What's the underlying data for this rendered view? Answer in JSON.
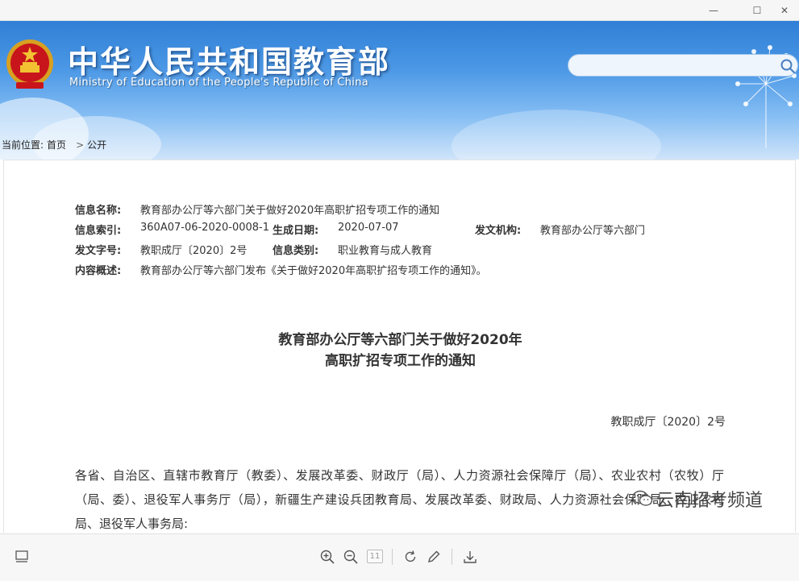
{
  "window": {
    "minimize_glyph": "—",
    "maximize_glyph": "☐",
    "close_glyph": "✕"
  },
  "header": {
    "title": "中华人民共和国教育部",
    "subtitle": "Ministry of Education of the People's Republic of China",
    "emblem_icon": "national-emblem-icon",
    "search": {
      "placeholder": "",
      "icon": "search-icon"
    }
  },
  "breadcrumb": {
    "prefix": "当前位置:",
    "items": [
      "首页",
      "公开"
    ],
    "separator": ">"
  },
  "meta": {
    "name_label": "信息名称:",
    "name_value": "教育部办公厅等六部门关于做好2020年高职扩招专项工作的通知",
    "index_label": "信息索引:",
    "index_value": "360A07-06-2020-0008-1",
    "date_label": "生成日期:",
    "date_value": "2020-07-07",
    "issuer_label": "发文机构:",
    "issuer_value": "教育部办公厅等六部门",
    "docno_label": "发文字号:",
    "docno_value": "教职成厅〔2020〕2号",
    "category_label": "信息类别:",
    "category_value": "职业教育与成人教育",
    "summary_label": "内容概述:",
    "summary_value": "教育部办公厅等六部门发布《关于做好2020年高职扩招专项工作的通知》。"
  },
  "document": {
    "title_line1": "教育部办公厅等六部门关于做好2020年",
    "title_line2": "高职扩招专项工作的通知",
    "number": "教职成厅〔2020〕2号",
    "body": "各省、自治区、直辖市教育厅（教委）、发展改革委、财政厅（局）、人力资源社会保障厅（局）、农业农村（农牧）厅（局、委）、退役军人事务厅（局），新疆生产建设兵团教育局、发展改革委、财政局、人力资源社会保障局、农业农村局、退役军人事务局:"
  },
  "watermark": {
    "text": "云南招考频道",
    "icon": "wechat-icon"
  },
  "toolbar": {
    "page_number": "11",
    "icons": [
      "thumbnail-icon",
      "zoom-in-icon",
      "zoom-out-icon",
      "rotate-icon",
      "annotate-icon",
      "download-icon"
    ]
  },
  "colors": {
    "header_top": "#2f7fd6",
    "header_bottom": "#cfe4fa",
    "text": "#333333"
  }
}
